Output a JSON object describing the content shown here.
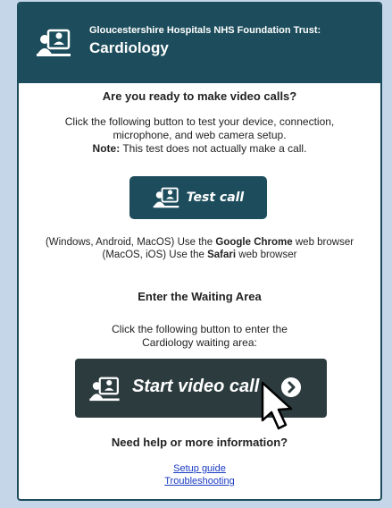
{
  "header": {
    "org": "Gloucestershire Hospitals NHS Foundation Trust:",
    "title": "Cardiology"
  },
  "ready": {
    "heading": "Are you ready to make video calls?",
    "line1": "Click the following button to test your device, connection,",
    "line2": "microphone, and web camera setup.",
    "note_label": "Note:",
    "note_text": " This test does not actually make a call."
  },
  "test_button": {
    "label": "Test call",
    "icon": "video-call-icon"
  },
  "browsers": {
    "l1_pre": "(Windows, Android, MacOS) Use the ",
    "l1_bold": "Google Chrome",
    "l1_post": " web browser",
    "l2_pre": "(MacOS, iOS) Use the ",
    "l2_bold": "Safari",
    "l2_post": " web browser"
  },
  "waiting": {
    "heading": "Enter the Waiting Area",
    "line1": "Click the following button to enter the",
    "line2": "Cardiology waiting area:"
  },
  "start_button": {
    "label": "Start video call",
    "icon": "video-call-icon",
    "arrow_icon": "chevron-right-icon"
  },
  "help": {
    "heading": "Need help or more information?",
    "setup_link": "Setup guide",
    "troubleshooting_link": "Troubleshooting"
  },
  "colors": {
    "header_bg": "#1d4d5c",
    "start_bg": "#2c3b3e",
    "page_bg": "#c5d6e8",
    "link": "#1a3ac2"
  }
}
